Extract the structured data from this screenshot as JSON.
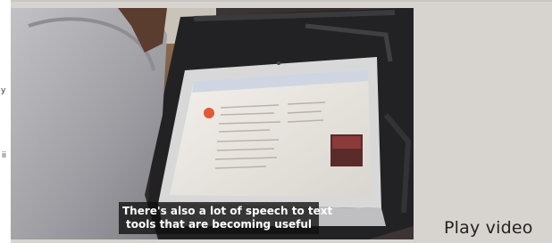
{
  "video": {
    "caption_line1": "There's also a lot of speech to text",
    "caption_line2": "tools that are becoming useful",
    "play_label": "Play video"
  },
  "sidebar": {
    "fragment_top": "y",
    "fragment_bottom": "ii"
  },
  "colors": {
    "background": "#d7d4cf",
    "caption_bg": "#101010",
    "caption_text": "#ffffff",
    "laptop_case": "#2a2a2c",
    "hoodie": "#a7a7ab"
  }
}
